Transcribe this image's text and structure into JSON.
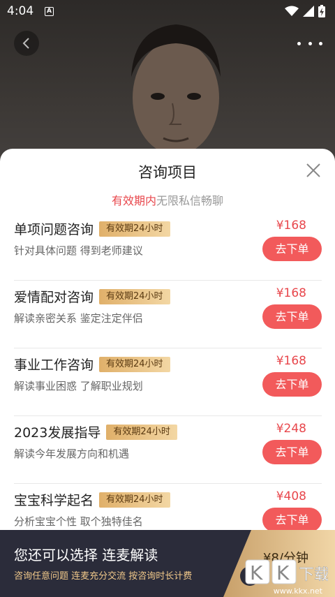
{
  "status_bar": {
    "time": "4:04",
    "notif": "A"
  },
  "sheet": {
    "title": "咨询项目",
    "subtitle_highlight": "有效期内",
    "subtitle_rest": "无限私信畅聊",
    "items": [
      {
        "name": "单项问题咨询",
        "badge": "有效期24小时",
        "desc": "针对具体问题 得到老师建议",
        "price": "¥168",
        "button": "去下单"
      },
      {
        "name": "爱情配对咨询",
        "badge": "有效期24小时",
        "desc": "解读亲密关系 鉴定注定伴侣",
        "price": "¥168",
        "button": "去下单"
      },
      {
        "name": "事业工作咨询",
        "badge": "有效期24小时",
        "desc": "解读事业困惑 了解职业规划",
        "price": "¥168",
        "button": "去下单"
      },
      {
        "name": "2023发展指导",
        "badge": "有效期24小时",
        "desc": "解读今年发展方向和机遇",
        "price": "¥248",
        "button": "去下单"
      },
      {
        "name": "宝宝科学起名",
        "badge": "有效期24小时",
        "desc": "分析宝宝个性 取个独特佳名",
        "price": "¥408",
        "button": "去下单"
      }
    ]
  },
  "banner": {
    "title": "您还可以选择 连麦解读",
    "subtitle": "咨询任意问题 连麦充分交流 按咨询时长计费",
    "price": "¥8/分钟"
  },
  "watermark": {
    "logo": "KK下载",
    "url": "www.kkx.net"
  },
  "colors": {
    "accent": "#f25a5b",
    "price": "#e8474c",
    "badge": "#e0b06a",
    "banner": "#2b2c3a"
  }
}
